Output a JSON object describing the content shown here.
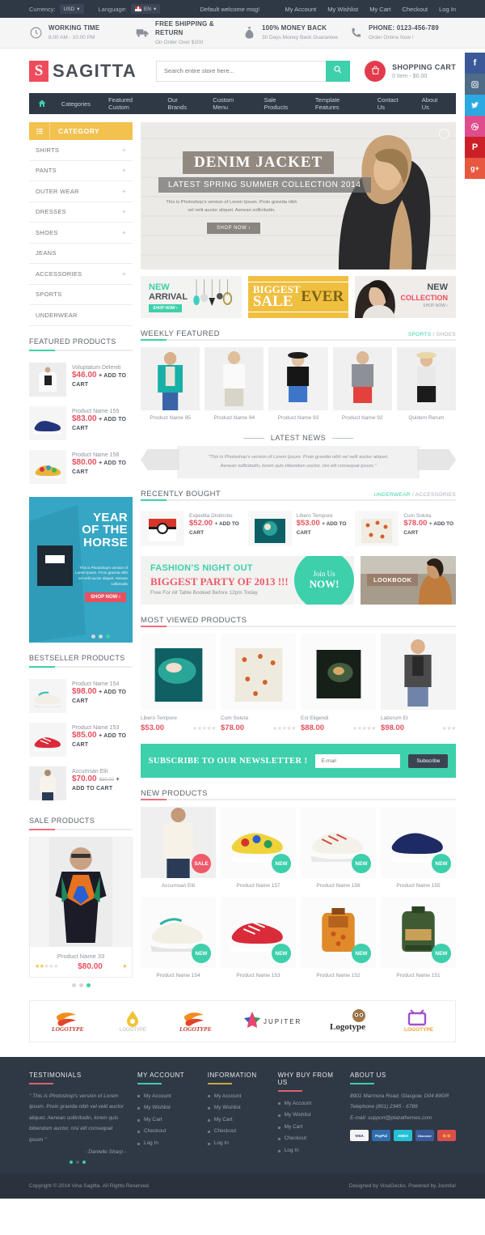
{
  "topbar": {
    "currency_label": "Currency:",
    "currency_value": "USD",
    "language_label": "Language:",
    "language_value": "EN",
    "welcome": "Default welcome msg!",
    "links": [
      "My Account",
      "My Wishlist",
      "My Cart",
      "Checkout",
      "Log In"
    ]
  },
  "info": [
    {
      "icon": "clock-icon",
      "title": "WORKING TIME",
      "sub": "8.00 AM - 10.00 PM"
    },
    {
      "icon": "truck-icon",
      "title": "FREE SHIPPING & RETURN",
      "sub": "On Order Over $100"
    },
    {
      "icon": "moneybag-icon",
      "title": "100% MONEY BACK",
      "sub": "30 Days Money Back Guarantee"
    },
    {
      "icon": "phone-icon",
      "title": "PHONE: 0123-456-789",
      "sub": "Order Online Now !"
    }
  ],
  "header": {
    "logo_mark": "S",
    "logo_text": "SAGITTA",
    "search_placeholder": "Search entire store here...",
    "search_value": "",
    "cart_title": "SHOPPING CART",
    "cart_sub": "0 Item - $0.00"
  },
  "nav": {
    "home_icon": "home-icon",
    "items": [
      "Categories",
      "Featured Custom",
      "Our Brands",
      "Custom Menu",
      "Sale Products",
      "Template Features",
      "Contact Us",
      "About Us"
    ]
  },
  "social": [
    {
      "name": "facebook-icon",
      "glyph": "f",
      "color": "#3b5998"
    },
    {
      "name": "instagram-icon",
      "glyph": "▣",
      "color": "#4e6b87"
    },
    {
      "name": "twitter-icon",
      "glyph": "ᵛ",
      "color": "#2ca9e1"
    },
    {
      "name": "dribbble-icon",
      "glyph": "●",
      "color": "#e04d8d"
    },
    {
      "name": "pinterest-icon",
      "glyph": "P",
      "color": "#cb2027"
    },
    {
      "name": "googleplus-icon",
      "glyph": "g+",
      "color": "#e8573f"
    }
  ],
  "sidebar": {
    "category_header": "CATEGORY",
    "categories": [
      {
        "label": "SHIRTS",
        "plus": "+"
      },
      {
        "label": "PANTS",
        "plus": "+"
      },
      {
        "label": "OUTER WEAR",
        "plus": "+"
      },
      {
        "label": "DRESSES",
        "plus": "+"
      },
      {
        "label": "SHOES",
        "plus": "+"
      },
      {
        "label": "JEANS",
        "plus": ""
      },
      {
        "label": "ACCESSORIES",
        "plus": "+"
      },
      {
        "label": "SPORTS",
        "plus": ""
      },
      {
        "label": "UNDERWEAR",
        "plus": ""
      }
    ],
    "featured_title": "FEATURED PRODUCTS",
    "featured": [
      {
        "name": "Voluptatum Deleniti",
        "price": "$46.00",
        "old": "",
        "cart": "+ ADD TO CART"
      },
      {
        "name": "Product Name 155",
        "price": "$83.00",
        "old": "",
        "cart": "+ ADD TO CART"
      },
      {
        "name": "Product Name 156",
        "price": "$80.00",
        "old": "",
        "cart": "+ ADD TO CART"
      }
    ],
    "banner": {
      "line1": "YEAR",
      "line2": "OF THE",
      "line3": "HORSE",
      "text": "This is Photoshop's version of Lorem Ipsum. Proin gravida nibh vel velit auctor aliquet. Aenean sollicitudin",
      "button": "SHOP NOW ›"
    },
    "bestseller_title": "BESTSELLER PRODUCTS",
    "bestseller": [
      {
        "name": "Product Name 154",
        "price": "$98.00",
        "old": "",
        "cart": "+ ADD TO CART"
      },
      {
        "name": "Product Name 153",
        "price": "$85.00",
        "old": "",
        "cart": "+ ADD TO CART"
      },
      {
        "name": "Accumsan Elit",
        "price": "$70.00",
        "old": "$80.00",
        "cart": "+ ADD TO CART"
      }
    ],
    "sale_title": "SALE PRODUCTS",
    "sale_product": {
      "name": "Product Name 33",
      "price": "$80.00",
      "rating": 2
    }
  },
  "hero": {
    "title": "DENIM JACKET",
    "subtitle": "LATEST SPRING SUMMER COLLECTION 2014",
    "text": "This is Photoshop's version of Lorem Ipsum. Proin gravida nibh vel velit auctor aliquet. Aenean sollicitudin.",
    "button": "SHOP NOW ›"
  },
  "promos": {
    "p1_a": "NEW",
    "p1_b": "ARRIVAL",
    "p1_btn": "SHOP NOW ›",
    "p2_a": "BIGGEST",
    "p2_b": "SALE",
    "p2_c": "EVER",
    "p3_a": "NEW",
    "p3_b": "COLLECTION",
    "p3_c": "SHOP NOW ›"
  },
  "weekly": {
    "title": "WEEKLY FEATURED",
    "link_on": "SPORTS",
    "link_sep": "/",
    "link_off": "SHOES",
    "products": [
      {
        "name": "Product Name 95"
      },
      {
        "name": "Product Name 94"
      },
      {
        "name": "Product Name 93"
      },
      {
        "name": "Product Name 92"
      },
      {
        "name": "Quidem Rerum"
      }
    ]
  },
  "latest_news": {
    "title": "LATEST NEWS",
    "quote": "\"This is Photoshop's version of Lorem Ipsum. Proin gravida nibh vel velit auctor aliquet. Aenean sollicitudin, lorem quis bibendum auctor, nisi elit consequat ipsum.\""
  },
  "recently_bought": {
    "title": "RECENTLY BOUGHT",
    "link_on": "UNDERWEAR",
    "link_sep": "/",
    "link_off": "ACCESSORIES",
    "products": [
      {
        "name": "Expedita Distinctio",
        "price": "$52.00",
        "cart": "+ ADD TO CART"
      },
      {
        "name": "Libero Tempore",
        "price": "$53.00",
        "cart": "+ ADD TO CART"
      },
      {
        "name": "Cum Soluta",
        "price": "$78.00",
        "cart": "+ ADD TO CART"
      }
    ]
  },
  "fashion_banner": {
    "line1": "FASHION’S NIGHT OUT",
    "line2": "BIGGEST PARTY OF 2013 !!!",
    "line3": "Free For All Table Booked Before 12pm Today",
    "circle1": "Join Us",
    "circle2": "NOW!",
    "lookbook": "LOOKBOOK"
  },
  "most_viewed": {
    "title": "MOST VIEWED PRODUCTS",
    "products": [
      {
        "name": "Libero Tempore",
        "price": "$53.00",
        "rating": 0
      },
      {
        "name": "Cum Soluta",
        "price": "$78.00",
        "rating": 0
      },
      {
        "name": "Est Eligendi",
        "price": "$88.00",
        "rating": 0
      },
      {
        "name": "Laborum Et",
        "price": "$98.00",
        "rating": 0
      }
    ]
  },
  "newsletter": {
    "title": "SUBSCRIBE TO OUR NEWSLETTER !",
    "placeholder": "E-mail",
    "value": "",
    "button": "Subscribe"
  },
  "new_products": {
    "title": "NEW PRODUCTS",
    "items": [
      {
        "name": "Accumsan Elit",
        "badge": "SALE"
      },
      {
        "name": "Product Name 157",
        "badge": "NEW"
      },
      {
        "name": "Product Name 156",
        "badge": "NEW"
      },
      {
        "name": "Product Name 155",
        "badge": "NEW"
      },
      {
        "name": "Product Name 154",
        "badge": "NEW"
      },
      {
        "name": "Product Name 153",
        "badge": "NEW"
      },
      {
        "name": "Product Name 152",
        "badge": "NEW"
      },
      {
        "name": "Product Name 151",
        "badge": "NEW"
      }
    ]
  },
  "brands": [
    {
      "name": "LOGOTYPE",
      "style": "wave-red"
    },
    {
      "name": "LOGOTYPE",
      "style": "drop-yellow"
    },
    {
      "name": "LOGOTYPE",
      "style": "wave-red"
    },
    {
      "name": "JUPITER",
      "style": "star"
    },
    {
      "name": "Logotype",
      "style": "owl"
    },
    {
      "name": "LOGOTYPE",
      "style": "tv"
    }
  ],
  "footer": {
    "testimonials": {
      "title": "TESTIMONIALS",
      "accent": "#d9626f",
      "quote": "\" This is Photoshop's version of Lorem Ipsum. Proin gravida nibh vel velit auctor aliquet. Aenean sollicitudin, lorem quis bibendum auctor, nisi elit consequat ipsum \"",
      "author": "- Danielle Sharp -"
    },
    "columns": [
      {
        "title": "MY ACCOUNT",
        "accent": "#3ecfab",
        "items": [
          "My Account",
          "My Wishlist",
          "My Cart",
          "Checkout",
          "Log In"
        ]
      },
      {
        "title": "INFORMATION",
        "accent": "#c9a93c",
        "items": [
          "My Account",
          "My Wishlist",
          "My Cart",
          "Checkout",
          "Log In"
        ]
      },
      {
        "title": "WHY BUY FROM US",
        "accent": "#d9626f",
        "items": [
          "My Account",
          "My Wishlist",
          "My Cart",
          "Checkout",
          "Log In"
        ]
      }
    ],
    "about": {
      "title": "ABOUT US",
      "accent": "#3ecfab",
      "address": "8901 Marmora Road, Glasgow, D04 89GR",
      "phone": "Telephone (801) 2345 - 6789",
      "email": "E-mail: support@plazathemes.com",
      "cards": [
        {
          "label": "VISA",
          "bg": "#f4f4f4",
          "fg": "#1a1f71"
        },
        {
          "label": "PayPal",
          "bg": "#2f6fb0",
          "fg": "#ffffff"
        },
        {
          "label": "AMEX",
          "bg": "#25c0d5",
          "fg": "#ffffff"
        },
        {
          "label": "Discover",
          "bg": "#3b5a9a",
          "fg": "#ffffff"
        },
        {
          "label": "●●",
          "bg": "#d94f4f",
          "fg": "#f5a623"
        }
      ]
    }
  },
  "copyright": {
    "left": "Copyright © 2014 Vina Sagitta. All Rights Reserved.",
    "right": "Designed by VinaGecko. Powered by Joomla!"
  }
}
